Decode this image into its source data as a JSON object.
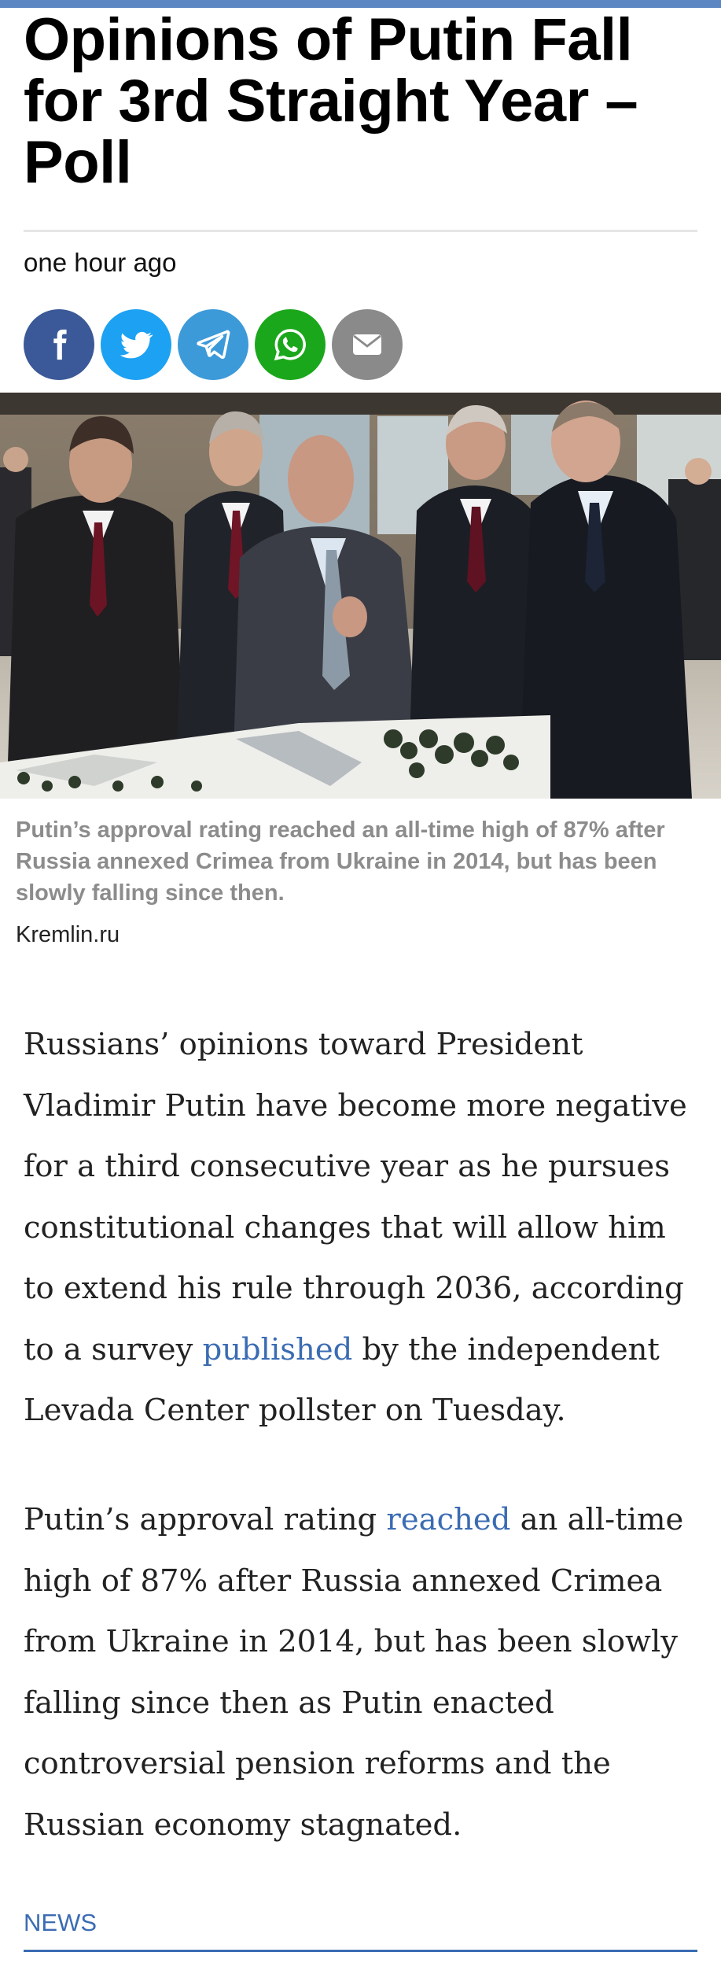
{
  "article": {
    "headline": "Opinions of Putin Fall for 3rd Straight Year – Poll",
    "timestamp": "one hour ago"
  },
  "share": {
    "icons": [
      "facebook-icon",
      "twitter-icon",
      "telegram-icon",
      "whatsapp-icon",
      "email-icon"
    ],
    "colors": {
      "facebook": "#3b5998",
      "twitter": "#1da1f2",
      "telegram": "#3d9ad9",
      "whatsapp": "#1ba71b",
      "email": "#8a8a8a"
    }
  },
  "photo": {
    "caption": "Putin’s approval rating reached an all-time high of 87% after Russia annexed Crimea from Ukraine in 2014, but has been slowly falling since then.",
    "credit": "Kremlin.ru"
  },
  "body": {
    "p1_before_link": "Russians’ opinions toward President Vladimir Putin have become more negative for a third consecutive year as he pursues constitutional changes that will allow him to extend his rule through 2036, according to a survey ",
    "p1_link": "published",
    "p1_after_link": " by the independent Levada Center pollster on Tuesday.",
    "p2_before_link": "Putin’s approval rating ",
    "p2_link": "reached",
    "p2_after_link": " an all-time high of 87% after Russia annexed Crimea from Ukraine in 2014, but has been slowly falling since then as Putin enacted controversial pension reforms and the Russian economy stagnated."
  },
  "footer": {
    "section_tag": "NEWS"
  },
  "theme": {
    "accent": "#3b6cb3",
    "top_strip": "#5b86c2"
  }
}
